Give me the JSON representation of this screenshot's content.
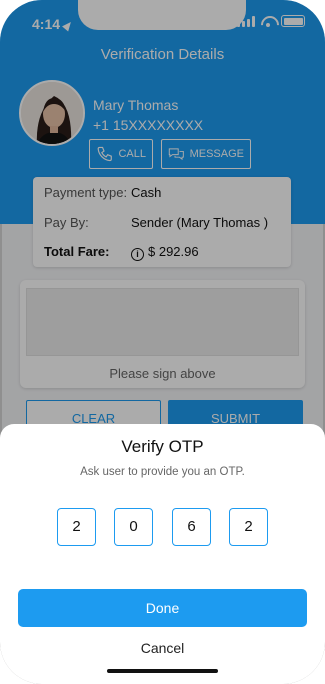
{
  "status_bar": {
    "time": "4:14"
  },
  "header": {
    "title": "Verification Details"
  },
  "driver": {
    "name": "Mary Thomas",
    "phone": "+1 15XXXXXXXX",
    "call_label": "CALL",
    "message_label": "MESSAGE"
  },
  "fare": {
    "payment_type_label": "Payment type:",
    "payment_type_value": "Cash",
    "pay_by_label": "Pay By:",
    "pay_by_value": "Sender (Mary Thomas )",
    "total_label": "Total Fare:",
    "total_value": "$ 292.96"
  },
  "signature": {
    "hint": "Please sign above"
  },
  "actions": {
    "clear_label": "CLEAR",
    "submit_label": "SUBMIT"
  },
  "otp_sheet": {
    "title": "Verify OTP",
    "subtitle": "Ask user to provide you an OTP.",
    "digits": [
      "2",
      "0",
      "6",
      "2"
    ],
    "done_label": "Done",
    "cancel_label": "Cancel"
  },
  "colors": {
    "accent": "#1d9bf0",
    "overlay": "rgba(0,0,0,0.33)"
  }
}
